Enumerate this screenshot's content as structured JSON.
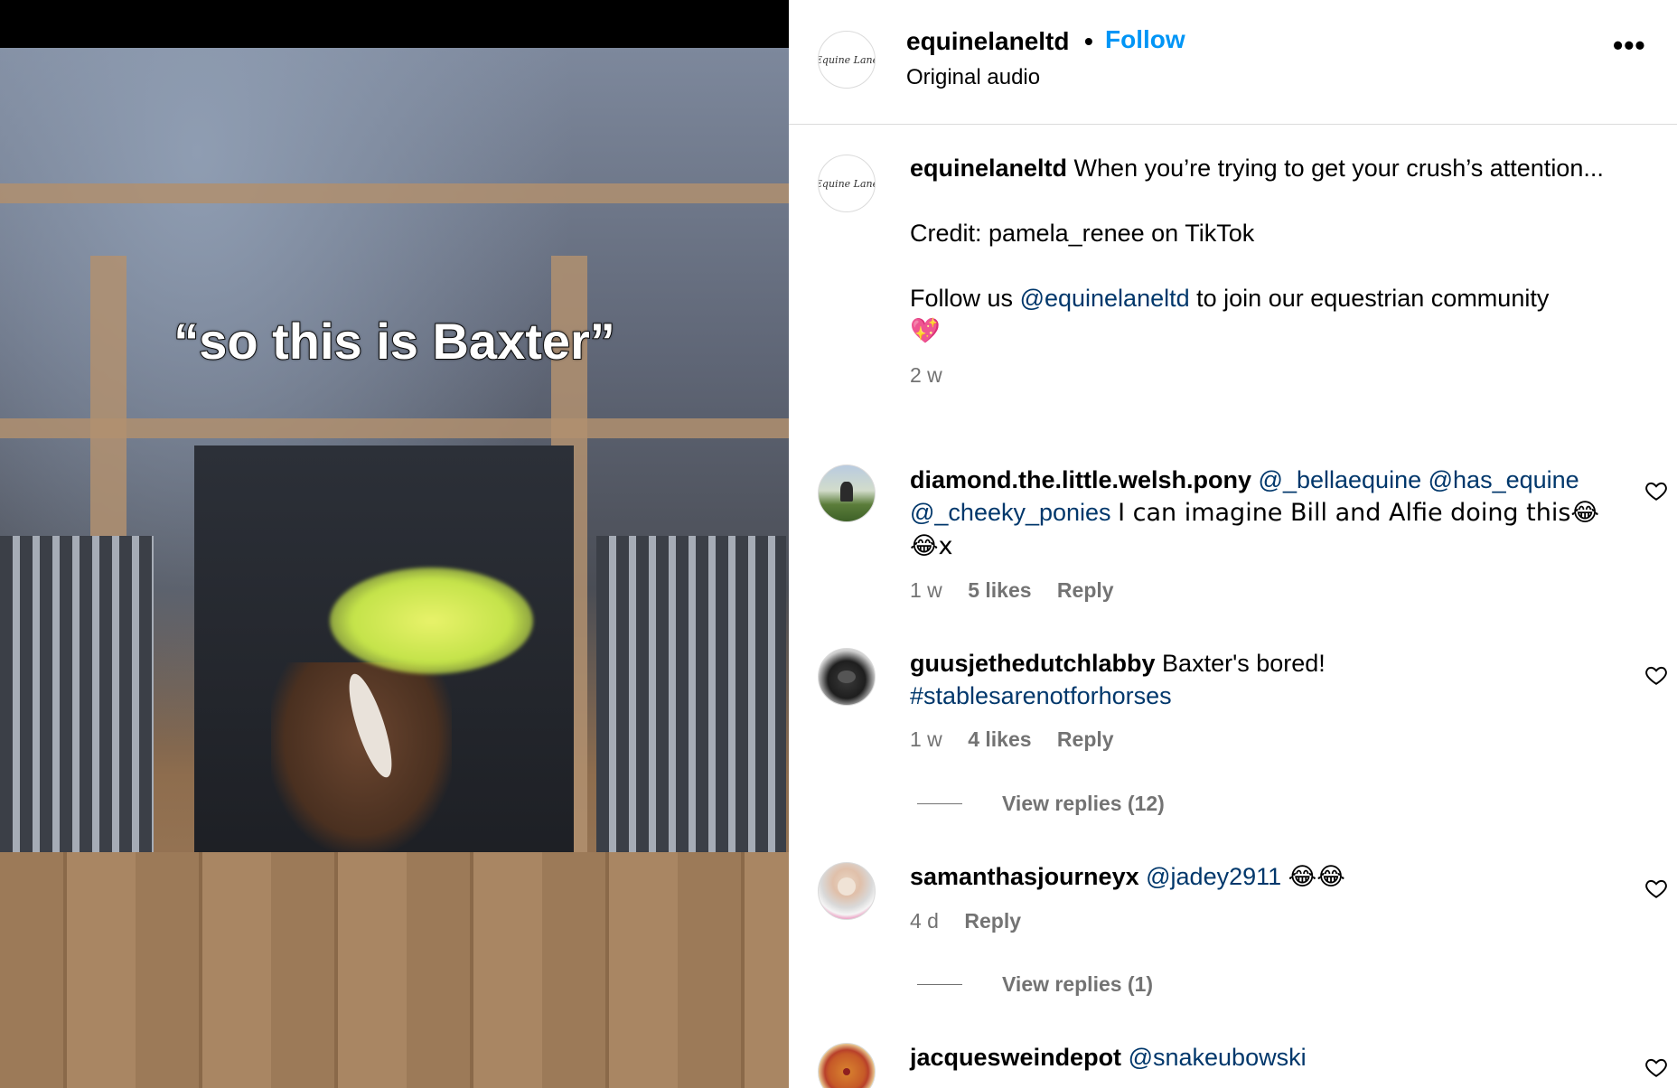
{
  "video": {
    "overlay_text": "“so this is Baxter”"
  },
  "header": {
    "username": "equinelaneltd",
    "separator": "•",
    "follow_label": "Follow",
    "audio_label": "Original audio",
    "more_label": "•••",
    "logo_text": "Equine Lane"
  },
  "caption": {
    "username": "equinelaneltd",
    "line1": "When you’re trying to get your crush’s attention...",
    "credit": "Credit: pamela_renee on TikTok",
    "follow_prefix": "Follow us",
    "follow_mention": "@equinelaneltd",
    "follow_suffix": "to join our equestrian community",
    "emoji": "💖",
    "time": "2 w"
  },
  "comments": [
    {
      "username": "diamond.the.little.welsh.pony",
      "mention1": "@_bellaequine",
      "mention2": "@has_equine",
      "mention3": "@_cheeky_ponies",
      "text": "I can imagine Bill and Alfie doing this😂😂x",
      "time": "1 w",
      "likes": "5 likes",
      "reply_label": "Reply"
    },
    {
      "username": "guusjethedutchlabby",
      "text": "Baxter's bored!",
      "hashtag": "#stablesarenotforhorses",
      "time": "1 w",
      "likes": "4 likes",
      "reply_label": "Reply",
      "view_replies": "View replies (12)"
    },
    {
      "username": "samanthasjourneyx",
      "mention1": "@jadey2911",
      "text": "😂😂",
      "time": "4 d",
      "reply_label": "Reply",
      "view_replies": "View replies (1)"
    },
    {
      "username": "jacquesweindepot",
      "mention1": "@snakeubowski"
    }
  ],
  "icons": {
    "heart": "heart-icon",
    "more": "more-options-icon"
  },
  "colors": {
    "follow_blue": "#0095f6",
    "link_blue": "#00376b",
    "meta_gray": "#737373"
  }
}
